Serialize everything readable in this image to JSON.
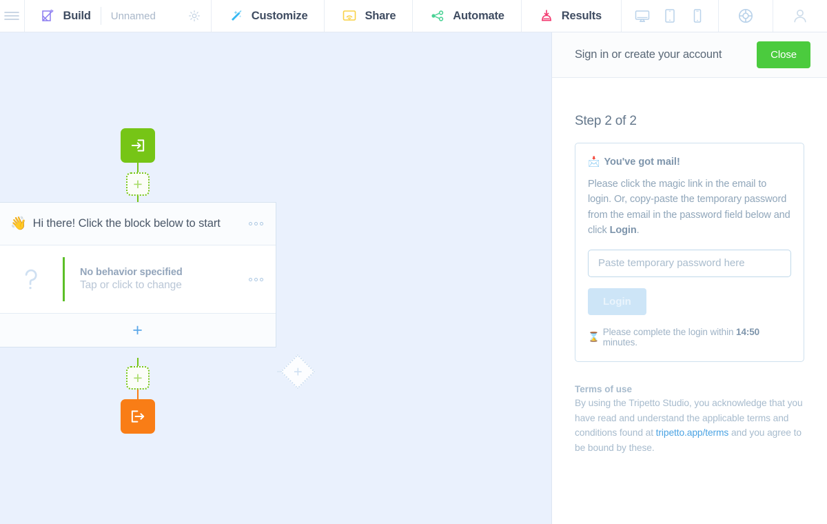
{
  "toolbar": {
    "menu_icon": "hamburger-menu-icon",
    "items": [
      {
        "label": "Build",
        "icon": "build-pencil-icon",
        "sub": "Unnamed",
        "settings_icon": "gear-icon"
      },
      {
        "label": "Customize",
        "icon": "magic-wand-icon"
      },
      {
        "label": "Share",
        "icon": "share-monitor-wifi-icon"
      },
      {
        "label": "Automate",
        "icon": "automate-nodes-icon"
      },
      {
        "label": "Results",
        "icon": "results-inbox-download-icon"
      }
    ],
    "devices": [
      {
        "icon": "desktop-monitor-icon"
      },
      {
        "icon": "tablet-icon"
      },
      {
        "icon": "mobile-phone-icon"
      }
    ],
    "help_icon": "life-ring-help-icon",
    "account_icon": "user-avatar-icon",
    "colors": {
      "build": "#8b7cf0",
      "customize": "#35b8f2",
      "share": "#f9d145",
      "automate": "#4ad295",
      "results": "#f2376e",
      "device": "#b9d2ea"
    }
  },
  "canvas": {
    "background": "#eaf1fd",
    "start_node": {
      "icon": "sign-in-arrow-icon",
      "color": "#76c516"
    },
    "end_node": {
      "icon": "sign-out-arrow-icon",
      "color": "#f97d16"
    },
    "add_placeholder_top": {
      "icon": "plus-icon",
      "label": "+"
    },
    "add_placeholder_bottom": {
      "icon": "plus-icon",
      "label": "+"
    },
    "add_placeholder_side": {
      "icon": "plus-icon",
      "label": "+"
    },
    "cluster": {
      "header": {
        "emoji": "👋",
        "emoji_name": "waving-hand-emoji",
        "title": "Hi there! Click the block below to start",
        "menu_icon": "ellipsis-menu-icon"
      },
      "body": {
        "icon": "question-mark-icon",
        "accent_color": "#5cbf27",
        "title": "No behavior specified",
        "subtitle": "Tap or click to change",
        "menu_icon": "ellipsis-menu-icon"
      },
      "footer": {
        "add_label": "+",
        "icon": "plus-icon"
      }
    }
  },
  "panel": {
    "header": {
      "title": "Sign in or create your account",
      "close_label": "Close",
      "close_color": "#4bcb3e"
    },
    "step_label": "Step 2 of 2",
    "login_card": {
      "heading_emoji": "📩",
      "heading_emoji_name": "incoming-envelope-emoji",
      "heading": "You've got mail!",
      "paragraph_part1": "Please click the magic link in the email to login. Or, copy-paste the temporary password from the email in the password field below and click ",
      "paragraph_bold": "Login",
      "paragraph_part2": ".",
      "password_placeholder": "Paste temporary password here",
      "password_value": "",
      "login_label": "Login",
      "timer_emoji": "⌛",
      "timer_emoji_name": "hourglass-emoji",
      "timer_prefix": "Please complete the login within ",
      "timer_value": "14:50",
      "timer_suffix": " minutes."
    },
    "terms": {
      "title": "Terms of use",
      "part1": "By using the Tripetto Studio, you acknowledge that you have read and understand the applicable terms and conditions found at ",
      "link": "tripetto.app/terms",
      "part2": " and you agree to be bound by these."
    }
  }
}
